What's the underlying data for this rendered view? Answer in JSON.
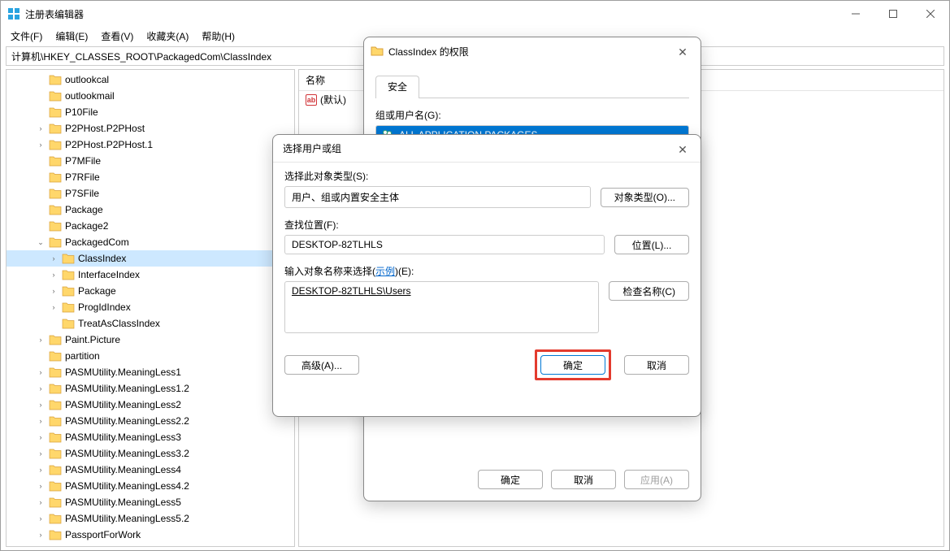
{
  "titlebar": {
    "title": "注册表编辑器"
  },
  "menu": {
    "file": "文件(F)",
    "edit": "编辑(E)",
    "view": "查看(V)",
    "fav": "收藏夹(A)",
    "help": "帮助(H)"
  },
  "address": "计算机\\HKEY_CLASSES_ROOT\\PackagedCom\\ClassIndex",
  "list": {
    "col_name": "名称",
    "default_label": "(默认)"
  },
  "tree": [
    {
      "indent": 2,
      "exp": "",
      "label": "outlookcal"
    },
    {
      "indent": 2,
      "exp": "",
      "label": "outlookmail"
    },
    {
      "indent": 2,
      "exp": "",
      "label": "P10File"
    },
    {
      "indent": 2,
      "exp": ">",
      "label": "P2PHost.P2PHost"
    },
    {
      "indent": 2,
      "exp": ">",
      "label": "P2PHost.P2PHost.1"
    },
    {
      "indent": 2,
      "exp": "",
      "label": "P7MFile"
    },
    {
      "indent": 2,
      "exp": "",
      "label": "P7RFile"
    },
    {
      "indent": 2,
      "exp": "",
      "label": "P7SFile"
    },
    {
      "indent": 2,
      "exp": "",
      "label": "Package"
    },
    {
      "indent": 2,
      "exp": "",
      "label": "Package2"
    },
    {
      "indent": 2,
      "exp": "v",
      "label": "PackagedCom"
    },
    {
      "indent": 3,
      "exp": ">",
      "label": "ClassIndex",
      "selected": true
    },
    {
      "indent": 3,
      "exp": ">",
      "label": "InterfaceIndex"
    },
    {
      "indent": 3,
      "exp": ">",
      "label": "Package"
    },
    {
      "indent": 3,
      "exp": ">",
      "label": "ProgIdIndex"
    },
    {
      "indent": 3,
      "exp": "",
      "label": "TreatAsClassIndex"
    },
    {
      "indent": 2,
      "exp": ">",
      "label": "Paint.Picture"
    },
    {
      "indent": 2,
      "exp": "",
      "label": "partition"
    },
    {
      "indent": 2,
      "exp": ">",
      "label": "PASMUtility.MeaningLess1"
    },
    {
      "indent": 2,
      "exp": ">",
      "label": "PASMUtility.MeaningLess1.2"
    },
    {
      "indent": 2,
      "exp": ">",
      "label": "PASMUtility.MeaningLess2"
    },
    {
      "indent": 2,
      "exp": ">",
      "label": "PASMUtility.MeaningLess2.2"
    },
    {
      "indent": 2,
      "exp": ">",
      "label": "PASMUtility.MeaningLess3"
    },
    {
      "indent": 2,
      "exp": ">",
      "label": "PASMUtility.MeaningLess3.2"
    },
    {
      "indent": 2,
      "exp": ">",
      "label": "PASMUtility.MeaningLess4"
    },
    {
      "indent": 2,
      "exp": ">",
      "label": "PASMUtility.MeaningLess4.2"
    },
    {
      "indent": 2,
      "exp": ">",
      "label": "PASMUtility.MeaningLess5"
    },
    {
      "indent": 2,
      "exp": ">",
      "label": "PASMUtility.MeaningLess5.2"
    },
    {
      "indent": 2,
      "exp": ">",
      "label": "PassportForWork"
    }
  ],
  "perm_dialog": {
    "title": "ClassIndex 的权限",
    "tab_security": "安全",
    "groups_label": "组或用户名(G):",
    "group0": "ALL APPLICATION PACKAGES",
    "ok": "确定",
    "cancel": "取消",
    "apply": "应用(A)"
  },
  "sel_dialog": {
    "title": "选择用户或组",
    "obj_type_label": "选择此对象类型(S):",
    "obj_type_value": "用户、组或内置安全主体",
    "obj_type_btn": "对象类型(O)...",
    "loc_label": "查找位置(F):",
    "loc_value": "DESKTOP-82TLHLS",
    "loc_btn": "位置(L)...",
    "names_label_pre": "输入对象名称来选择(",
    "names_label_link": "示例",
    "names_label_post": ")(E):",
    "names_value": "DESKTOP-82TLHLS\\Users",
    "check_btn": "检查名称(C)",
    "adv_btn": "高级(A)...",
    "ok": "确定",
    "cancel": "取消"
  }
}
